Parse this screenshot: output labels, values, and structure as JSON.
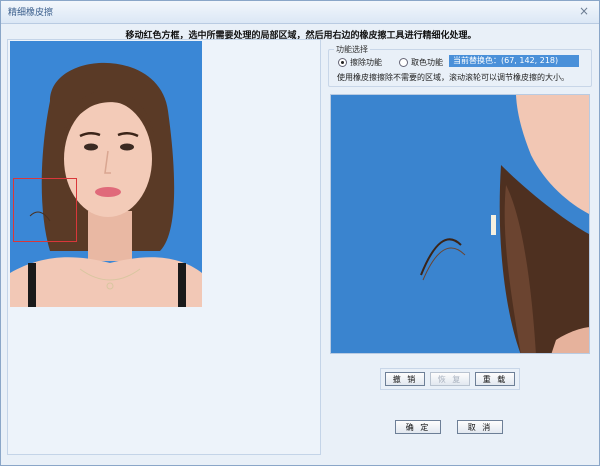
{
  "window": {
    "title": "精细橡皮擦",
    "close_label": "×"
  },
  "instruction": "移动红色方框，选中所需要处理的局部区域，然后用右边的橡皮擦工具进行精细化处理。",
  "function_group": {
    "label": "功能选择",
    "options": [
      {
        "label": "擦除功能",
        "selected": true
      },
      {
        "label": "取色功能",
        "selected": false
      }
    ],
    "replace_color_text": "当前替换色：(67, 142, 218)",
    "replace_color_hex": "#4a90d9"
  },
  "hint": "使用橡皮擦擦除不需要的区域，滚动滚轮可以调节橡皮擦的大小。",
  "buttons": {
    "undo": "撤 销",
    "redo": "恢 复",
    "reload": "重 载",
    "ok": "确 定",
    "cancel": "取 消"
  },
  "colors": {
    "background_blue": "#3a87d6",
    "selection_red": "#d9373a"
  }
}
